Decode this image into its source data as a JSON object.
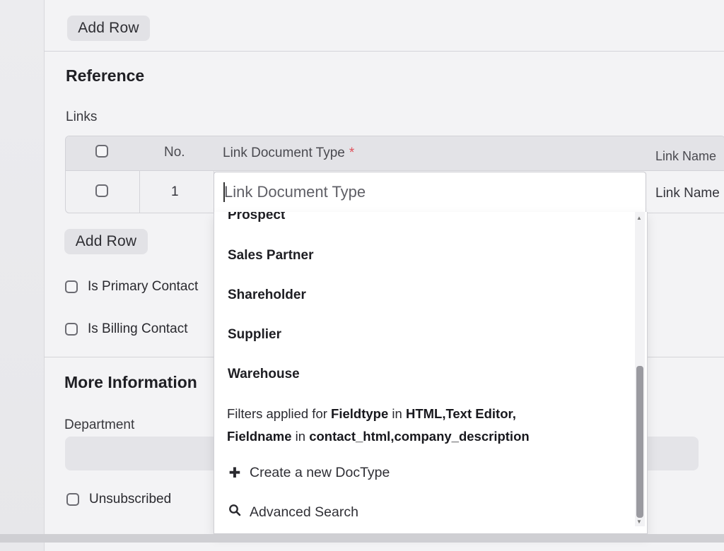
{
  "top": {
    "add_row_label": "Add Row"
  },
  "reference": {
    "heading": "Reference",
    "links_label": "Links",
    "table": {
      "headers": {
        "no": "No.",
        "link_document_type": "Link Document Type",
        "required_mark": "*",
        "link_name": "Link Name"
      },
      "rows": [
        {
          "no": "1",
          "link_document_type_placeholder": "Link Document Type",
          "link_name": "Link Name"
        }
      ]
    },
    "add_row_label": "Add Row",
    "is_primary_contact": "Is Primary Contact",
    "is_billing_contact": "Is Billing Contact"
  },
  "more_information": {
    "heading": "More Information",
    "department_label": "Department",
    "unsubscribed_label": "Unsubscribed"
  },
  "dropdown": {
    "items": [
      "Prospect",
      "Sales Partner",
      "Shareholder",
      "Supplier",
      "Warehouse"
    ],
    "filter_text": {
      "prefix": "Filters applied for",
      "field1_name": "Fieldtype",
      "in1": "in",
      "field1_values": "HTML,Text Editor,",
      "field2_name": "Fieldname",
      "in2": "in",
      "field2_values": "contact_html,company_description"
    },
    "create_new_label": "Create a new DocType",
    "create_new_icon": "plus-icon",
    "advanced_search_label": "Advanced Search",
    "advanced_search_icon": "search-icon"
  },
  "colors": {
    "required": "#e0505a",
    "background": "#f3f3f5",
    "button": "#e2e2e6"
  }
}
